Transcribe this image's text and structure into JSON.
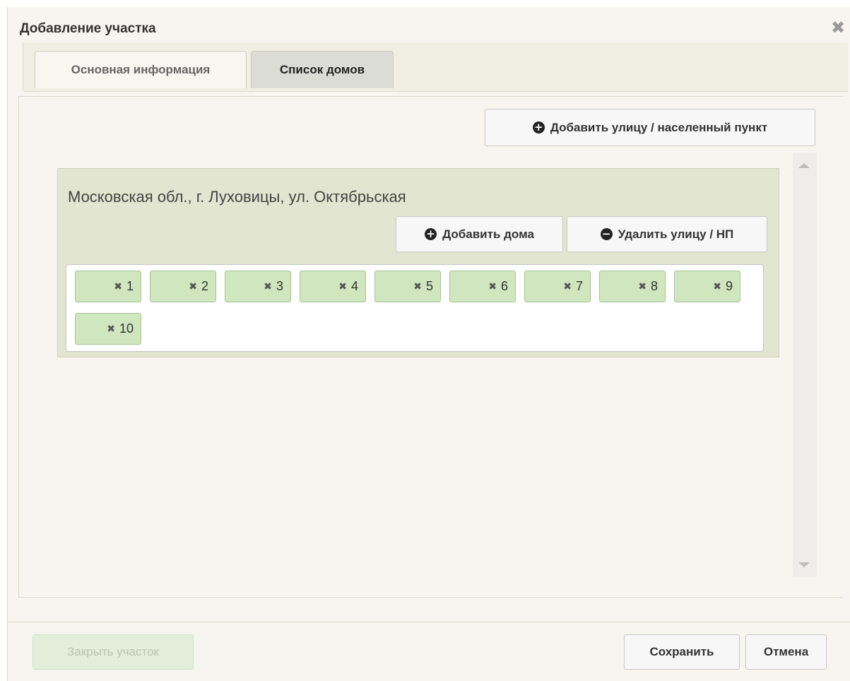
{
  "dialog": {
    "title": "Добавление участка"
  },
  "tabs": [
    {
      "label": "Основная информация",
      "active": false
    },
    {
      "label": "Список домов",
      "active": true
    }
  ],
  "toolbar": {
    "add_street_label": "Добавить улицу / населенный пункт"
  },
  "street": {
    "title": "Московская обл., г. Луховицы, ул. Октябрьская",
    "add_houses_label": "Добавить дома",
    "remove_street_label": "Удалить улицу / НП",
    "houses": [
      "1",
      "2",
      "3",
      "4",
      "5",
      "6",
      "7",
      "8",
      "9",
      "10"
    ]
  },
  "footer": {
    "close_plot_label": "Закрыть участок",
    "save_label": "Сохранить",
    "cancel_label": "Отмена"
  },
  "icons": {
    "close": "close-icon",
    "plus_circle": "plus-circle-icon",
    "minus_circle": "minus-circle-icon",
    "chip_remove": "remove-icon"
  },
  "colors": {
    "dialog_bg": "#f6f5ef",
    "street_block_bg": "#e2e5cf",
    "chip_bg": "#cfe6bf",
    "disabled_button_bg": "#e3eedb"
  }
}
